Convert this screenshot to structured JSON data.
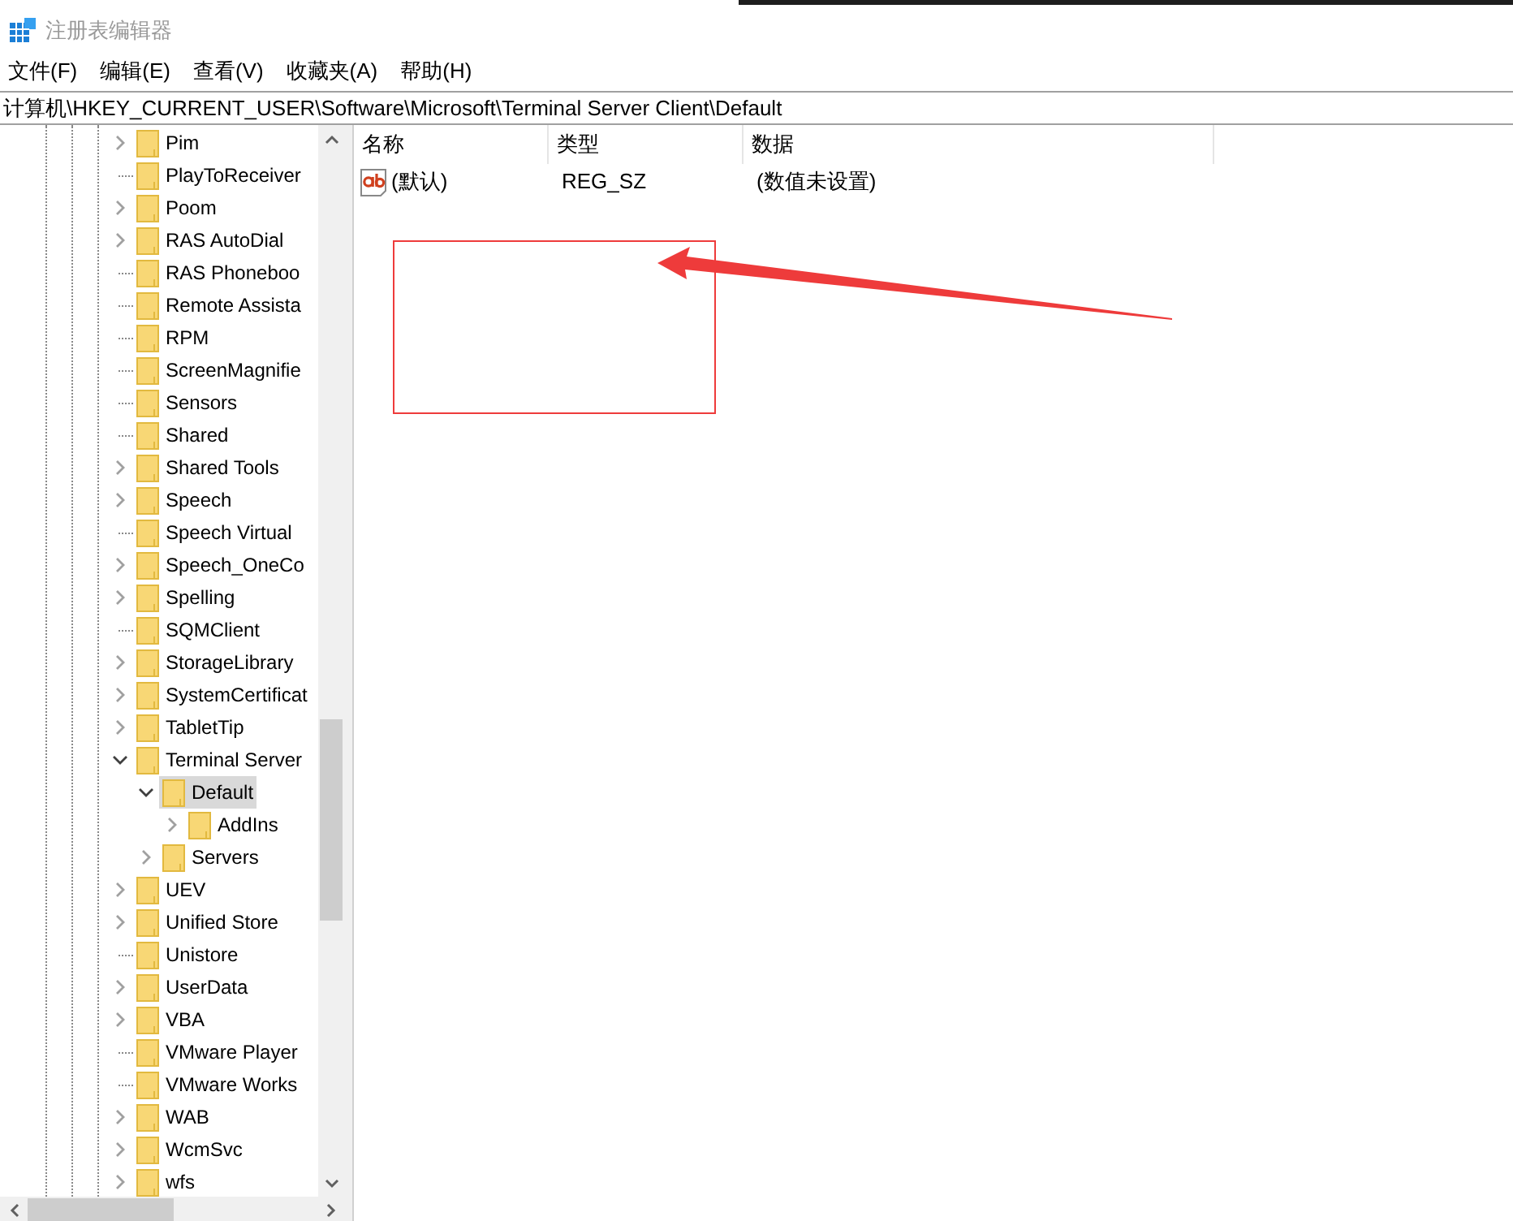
{
  "window": {
    "title": "注册表编辑器"
  },
  "menu": [
    "文件(F)",
    "编辑(E)",
    "查看(V)",
    "收藏夹(A)",
    "帮助(H)"
  ],
  "address_bar": {
    "value": "计算机\\HKEY_CURRENT_USER\\Software\\Microsoft\\Terminal Server Client\\Default"
  },
  "tree": [
    {
      "label": "Pim",
      "expandable": true,
      "expanded": false,
      "selected": false
    },
    {
      "label": "PlayToReceiver",
      "expandable": false,
      "expanded": false,
      "selected": false
    },
    {
      "label": "Poom",
      "expandable": true,
      "expanded": false,
      "selected": false
    },
    {
      "label": "RAS AutoDial",
      "expandable": true,
      "expanded": false,
      "selected": false
    },
    {
      "label": "RAS Phoneboo",
      "expandable": false,
      "expanded": false,
      "selected": false
    },
    {
      "label": "Remote Assista",
      "expandable": false,
      "expanded": false,
      "selected": false
    },
    {
      "label": "RPM",
      "expandable": false,
      "expanded": false,
      "selected": false
    },
    {
      "label": "ScreenMagnifie",
      "expandable": false,
      "expanded": false,
      "selected": false
    },
    {
      "label": "Sensors",
      "expandable": false,
      "expanded": false,
      "selected": false
    },
    {
      "label": "Shared",
      "expandable": false,
      "expanded": false,
      "selected": false
    },
    {
      "label": "Shared Tools",
      "expandable": true,
      "expanded": false,
      "selected": false
    },
    {
      "label": "Speech",
      "expandable": true,
      "expanded": false,
      "selected": false
    },
    {
      "label": "Speech Virtual",
      "expandable": false,
      "expanded": false,
      "selected": false
    },
    {
      "label": "Speech_OneCo",
      "expandable": true,
      "expanded": false,
      "selected": false
    },
    {
      "label": "Spelling",
      "expandable": true,
      "expanded": false,
      "selected": false
    },
    {
      "label": "SQMClient",
      "expandable": false,
      "expanded": false,
      "selected": false
    },
    {
      "label": "StorageLibrary",
      "expandable": true,
      "expanded": false,
      "selected": false
    },
    {
      "label": "SystemCertificat",
      "expandable": true,
      "expanded": false,
      "selected": false
    },
    {
      "label": "TabletTip",
      "expandable": true,
      "expanded": false,
      "selected": false
    },
    {
      "label": "Terminal Server",
      "expandable": true,
      "expanded": true,
      "selected": false,
      "children": [
        {
          "label": "Default",
          "expandable": true,
          "expanded": true,
          "selected": true,
          "children": [
            {
              "label": "AddIns",
              "expandable": true,
              "expanded": false,
              "selected": false
            }
          ]
        },
        {
          "label": "Servers",
          "expandable": true,
          "expanded": false,
          "selected": false
        }
      ]
    },
    {
      "label": "UEV",
      "expandable": true,
      "expanded": false,
      "selected": false
    },
    {
      "label": "Unified Store",
      "expandable": true,
      "expanded": false,
      "selected": false
    },
    {
      "label": "Unistore",
      "expandable": false,
      "expanded": false,
      "selected": false
    },
    {
      "label": "UserData",
      "expandable": true,
      "expanded": false,
      "selected": false
    },
    {
      "label": "VBA",
      "expandable": true,
      "expanded": false,
      "selected": false
    },
    {
      "label": "VMware Player",
      "expandable": false,
      "expanded": false,
      "selected": false
    },
    {
      "label": "VMware Works",
      "expandable": false,
      "expanded": false,
      "selected": false
    },
    {
      "label": "WAB",
      "expandable": true,
      "expanded": false,
      "selected": false
    },
    {
      "label": "WcmSvc",
      "expandable": true,
      "expanded": false,
      "selected": false
    },
    {
      "label": "wfs",
      "expandable": true,
      "expanded": false,
      "selected": false
    }
  ],
  "values": {
    "columns": [
      "名称",
      "类型",
      "数据"
    ],
    "rows": [
      {
        "name": "(默认)",
        "type": "REG_SZ",
        "data": "(数值未设置)"
      }
    ]
  }
}
